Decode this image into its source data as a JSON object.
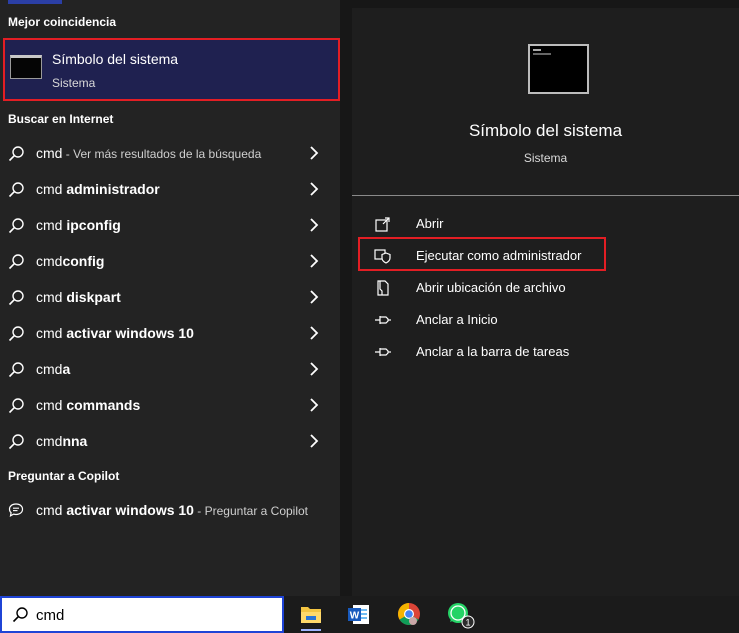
{
  "left": {
    "best_match_title": "Mejor coincidencia",
    "best_match": {
      "name": "Símbolo del sistema",
      "type": "Sistema"
    },
    "web_title": "Buscar en Internet",
    "web_results": [
      {
        "prefix": "cmd",
        "bold": "",
        "hint": " - Ver más resultados de la búsqueda"
      },
      {
        "prefix": "cmd ",
        "bold": "administrador",
        "hint": ""
      },
      {
        "prefix": "cmd ",
        "bold": "ipconfig",
        "hint": ""
      },
      {
        "prefix": "cmd",
        "bold": "config",
        "hint": ""
      },
      {
        "prefix": "cmd ",
        "bold": "diskpart",
        "hint": ""
      },
      {
        "prefix": "cmd ",
        "bold": "activar windows 10",
        "hint": ""
      },
      {
        "prefix": "cmd",
        "bold": "a",
        "hint": ""
      },
      {
        "prefix": "cmd ",
        "bold": "commands",
        "hint": ""
      },
      {
        "prefix": "cmd",
        "bold": "nna",
        "hint": ""
      }
    ],
    "copilot_title": "Preguntar a Copilot",
    "copilot_result": {
      "prefix": "cmd ",
      "bold": "activar windows 10",
      "hint": " - Preguntar a Copilot"
    }
  },
  "detail": {
    "name": "Símbolo del sistema",
    "type": "Sistema",
    "actions": [
      {
        "label": "Abrir",
        "icon": "open-icon"
      },
      {
        "label": "Ejecutar como administrador",
        "icon": "shield-icon"
      },
      {
        "label": "Abrir ubicación de archivo",
        "icon": "file-location-icon"
      },
      {
        "label": "Anclar a Inicio",
        "icon": "pin-icon"
      },
      {
        "label": "Anclar a la barra de tareas",
        "icon": "pin-icon"
      }
    ]
  },
  "taskbar": {
    "search_value": "cmd",
    "apps": [
      {
        "name": "file-explorer",
        "badge": ""
      },
      {
        "name": "word",
        "badge": ""
      },
      {
        "name": "chrome",
        "badge": ""
      },
      {
        "name": "whatsapp",
        "badge": "1"
      }
    ]
  },
  "colors": {
    "highlight_border": "#e31e24",
    "selected_bg": "#1f2150",
    "accent": "#2b3fa6"
  }
}
